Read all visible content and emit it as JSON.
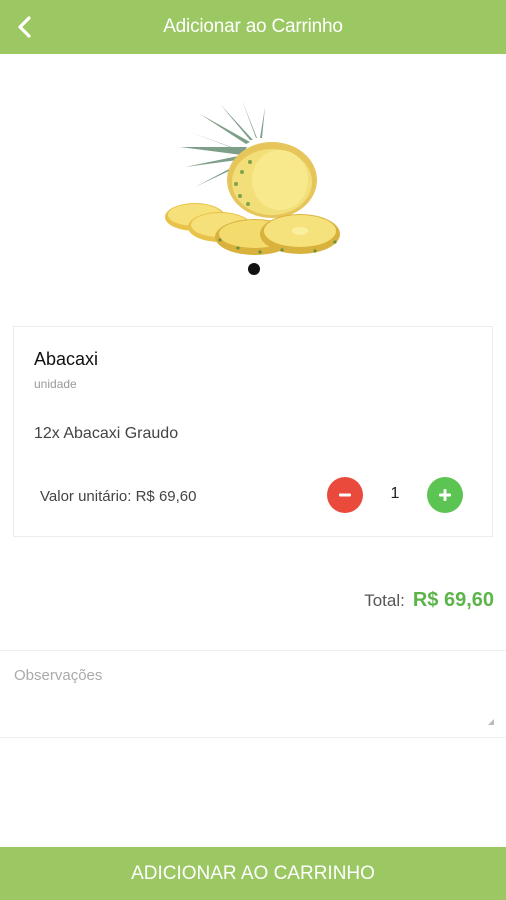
{
  "header": {
    "title": "Adicionar ao Carrinho",
    "back_icon": "chevron-left-icon"
  },
  "carousel": {
    "image": "pineapple",
    "dot_count": 1,
    "active_index": 0
  },
  "product": {
    "name": "Abacaxi",
    "unit": "unidade",
    "description": "12x Abacaxi Graudo",
    "unit_price_label": "Valor unitário: R$ 69,60",
    "quantity": "1"
  },
  "total": {
    "label": "Total:",
    "value": "R$ 69,60"
  },
  "notes": {
    "placeholder": "Observações",
    "value": ""
  },
  "footer": {
    "button_label": "ADICIONAR AO CARRINHO"
  },
  "colors": {
    "primary": "#9bc863",
    "minus": "#e94a3c",
    "plus": "#5cc452",
    "total": "#5cb44a"
  }
}
